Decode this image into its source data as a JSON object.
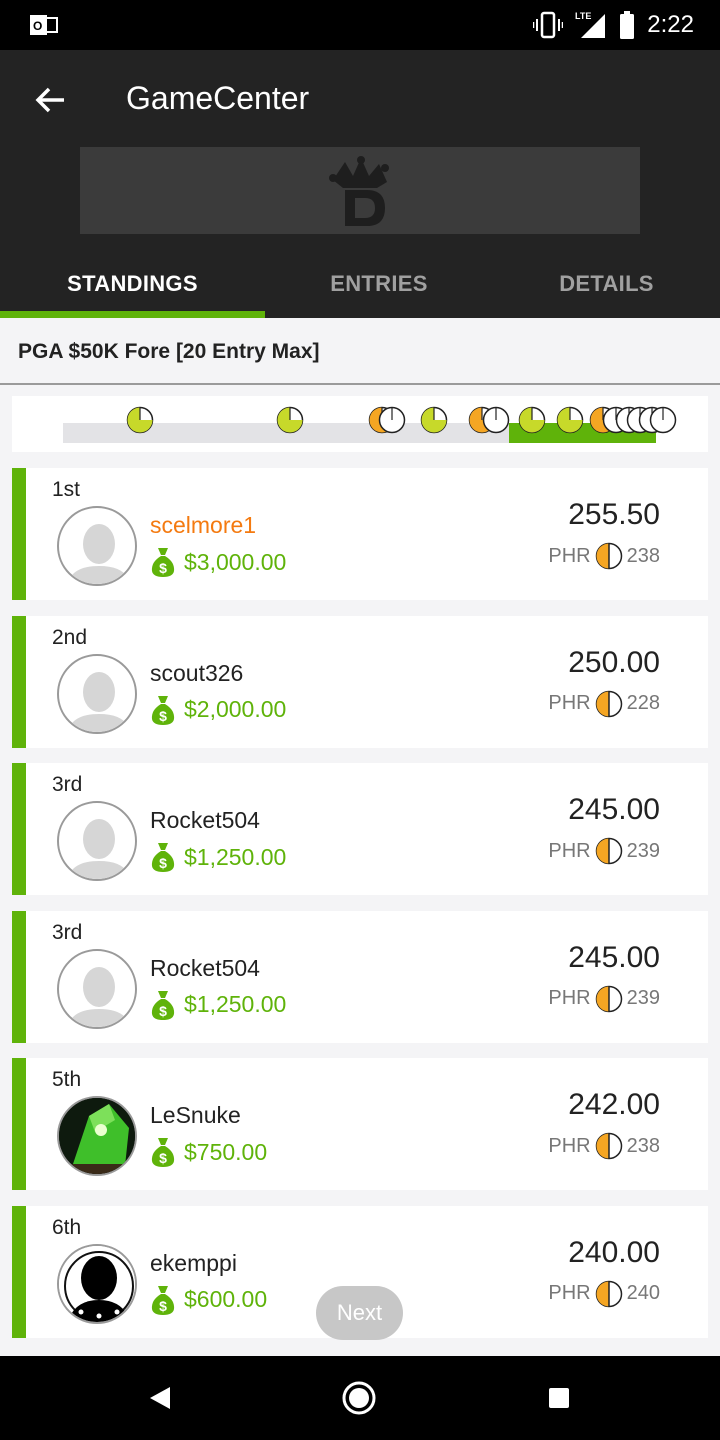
{
  "status_bar": {
    "time": "2:22",
    "network": "LTE"
  },
  "header": {
    "title": "GameCenter"
  },
  "tabs": [
    {
      "label": "STANDINGS",
      "active": true
    },
    {
      "label": "ENTRIES",
      "active": false
    },
    {
      "label": "DETAILS",
      "active": false
    }
  ],
  "contest": {
    "title": "PGA $50K Fore [20 Entry Max]"
  },
  "colors": {
    "accent": "#5fb30a",
    "highlight_user": "#f47a10",
    "header_bg": "#232323"
  },
  "standings": [
    {
      "rank": "1st",
      "username": "scelmore1",
      "is_me": true,
      "prize": "$3,000.00",
      "points": "255.50",
      "phr_label": "PHR",
      "phr": "238",
      "avatar": "default"
    },
    {
      "rank": "2nd",
      "username": "scout326",
      "is_me": false,
      "prize": "$2,000.00",
      "points": "250.00",
      "phr_label": "PHR",
      "phr": "228",
      "avatar": "default"
    },
    {
      "rank": "3rd",
      "username": "Rocket504",
      "is_me": false,
      "prize": "$1,250.00",
      "points": "245.00",
      "phr_label": "PHR",
      "phr": "239",
      "avatar": "default"
    },
    {
      "rank": "3rd",
      "username": "Rocket504",
      "is_me": false,
      "prize": "$1,250.00",
      "points": "245.00",
      "phr_label": "PHR",
      "phr": "239",
      "avatar": "default"
    },
    {
      "rank": "5th",
      "username": "LeSnuke",
      "is_me": false,
      "prize": "$750.00",
      "points": "242.00",
      "phr_label": "PHR",
      "phr": "238",
      "avatar": "green-photo"
    },
    {
      "rank": "6th",
      "username": "ekemppi",
      "is_me": false,
      "prize": "$600.00",
      "points": "240.00",
      "phr_label": "PHR",
      "phr": "240",
      "avatar": "black-silhouette"
    }
  ],
  "next_button": {
    "label": "Next"
  }
}
